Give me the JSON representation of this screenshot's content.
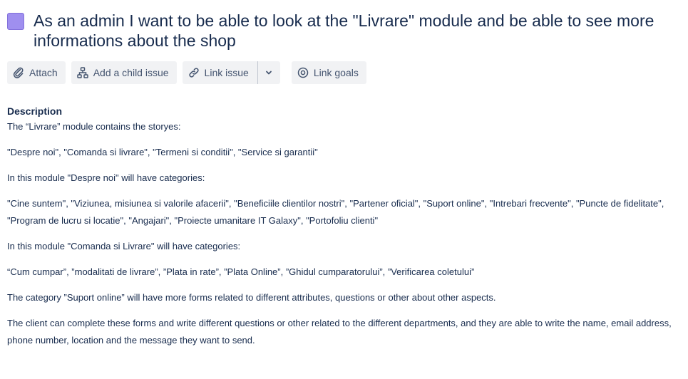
{
  "issue": {
    "type_icon": "story-purple-square-icon",
    "type_color": "#9f8fef",
    "title": "As an admin I want to be able to look at the \"Livrare\" module and be able to see more informations about the shop"
  },
  "toolbar": {
    "attach_label": "Attach",
    "add_child_label": "Add a child issue",
    "link_issue_label": "Link issue",
    "link_goals_label": "Link goals"
  },
  "description": {
    "heading": "Description",
    "paragraphs": [
      "The “Livrare” module contains the storyes:",
      "\"Despre noi\", \"Comanda si livrare\", \"Termeni si conditii\", \"Service si garantii\"",
      "In this module \"Despre noi\" will have categories:",
      "\"Cine suntem\", \"Viziunea, misiunea si valorile afacerii\", \"Beneficiile clientilor nostri\", \"Partener oficial\", \"Suport online\", \"Intrebari frecvente\", \"Puncte de fidelitate\", \"Program de lucru si locatie\", \"Angajari\", \"Proiecte umanitare IT Galaxy\", \"Portofoliu clienti\"",
      "In this module \"Comanda si Livrare\" will have categories:",
      "“Cum cumpar”, ”modalitati de livrare”, ”Plata in rate”, ”Plata Online”, ”Ghidul cumparatorului”, ”Verificarea coletului”",
      "The category ”Suport online” will have more forms related to different attributes, questions or other about other aspects.",
      "The client can complete these forms and write different questions or other related to the different departments, and they are able to write the name, email address, phone number, location and the message they want to send."
    ]
  }
}
